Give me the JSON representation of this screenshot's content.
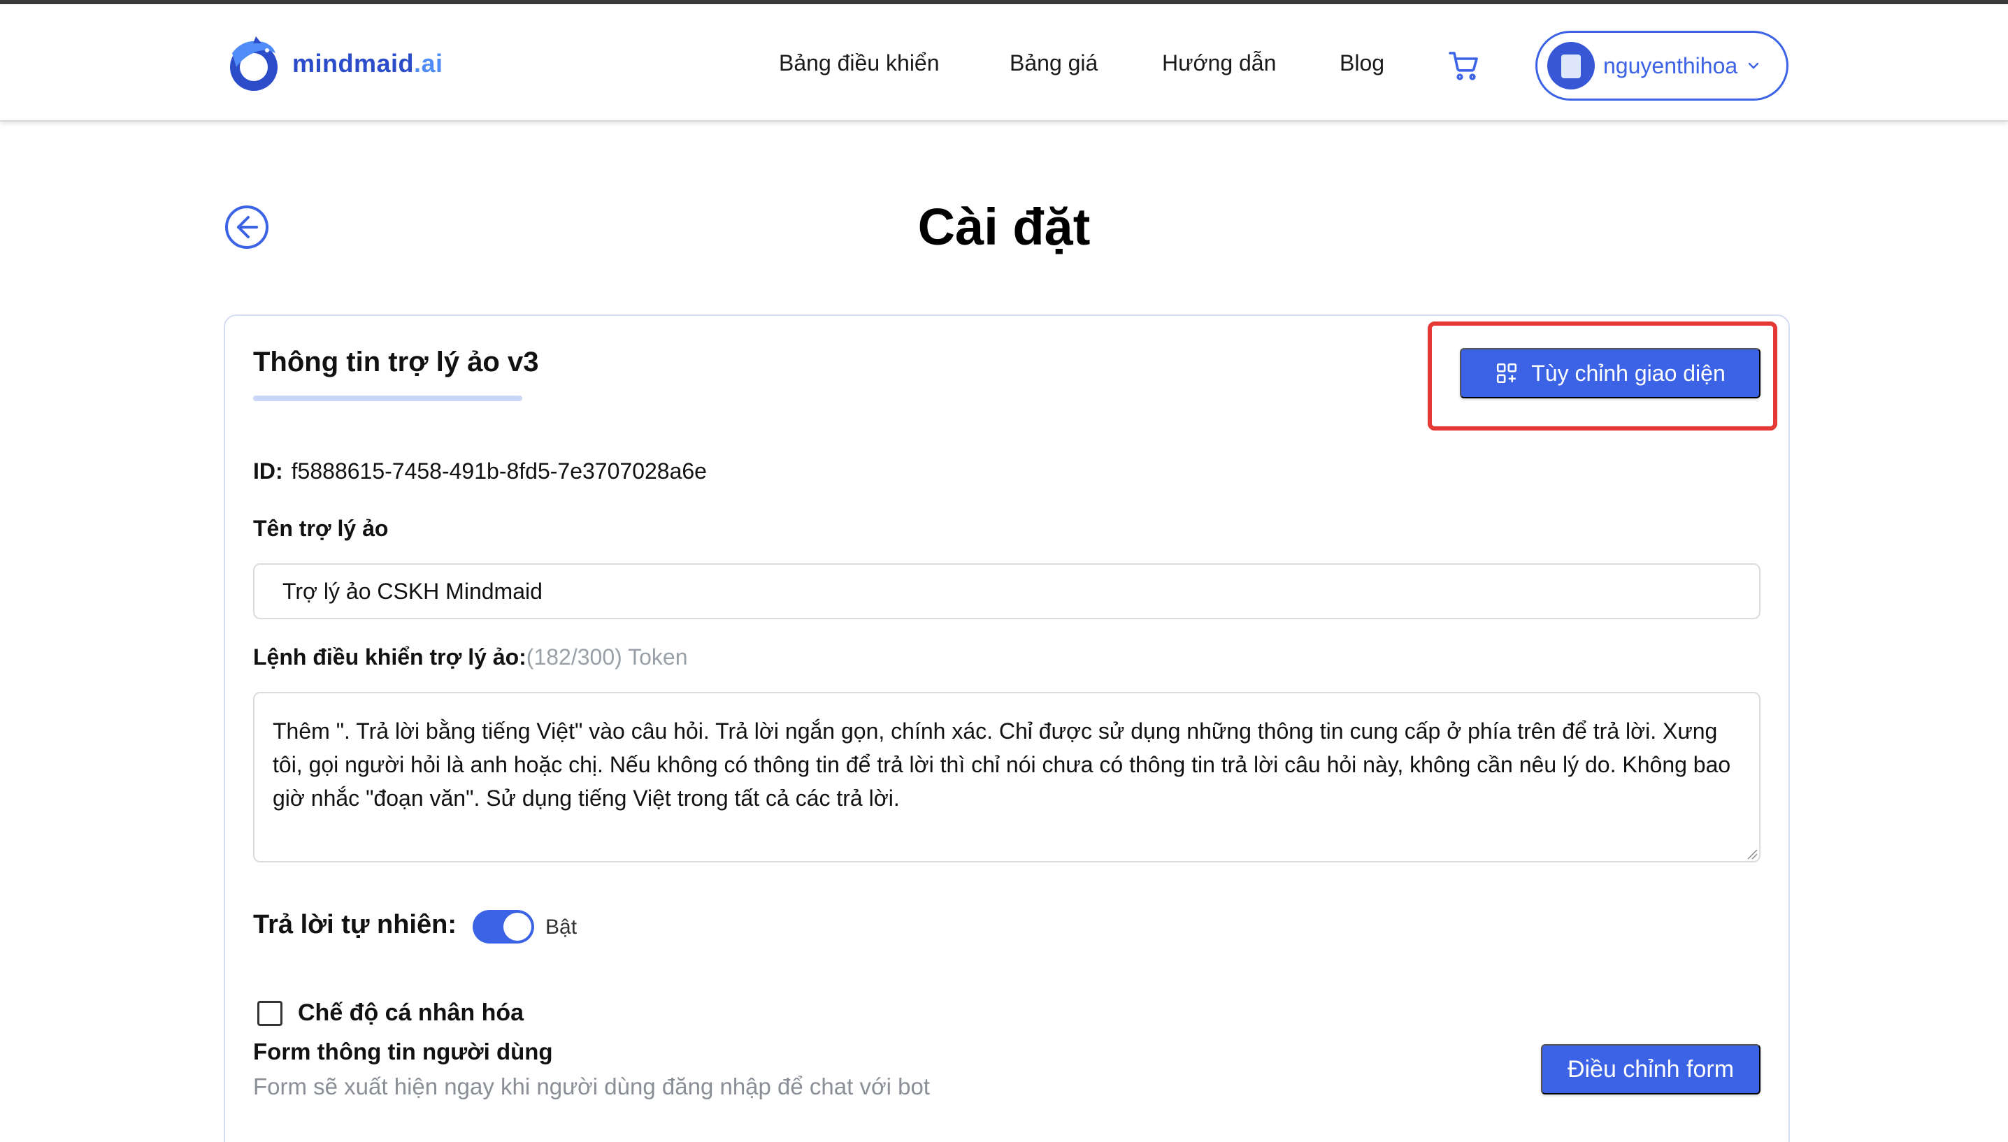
{
  "header": {
    "logo_text_main": "mindmaid",
    "logo_text_suffix": ".ai",
    "nav": [
      "Bảng điều khiển",
      "Bảng giá",
      "Hướng dẫn",
      "Blog"
    ],
    "username": "nguyenthihoa"
  },
  "page": {
    "title": "Cài đặt"
  },
  "card": {
    "title": "Thông tin trợ lý ảo v3",
    "customize_button": "Tùy chỉnh giao diện",
    "id_label": "ID:",
    "id_value": "f5888615-7458-491b-8fd5-7e3707028a6e",
    "name_label": "Tên trợ lý ảo",
    "name_value": "Trợ lý ảo CSKH Mindmaid",
    "prompt_label": "Lệnh điều khiển trợ lý ảo:",
    "prompt_token_note": "(182/300) Token",
    "prompt_value": "Thêm \". Trả lời bằng tiếng Việt\" vào câu hỏi. Trả lời ngắn gọn, chính xác. Chỉ được sử dụng những thông tin cung cấp ở phía trên để trả lời. Xưng tôi, gọi người hỏi là anh hoặc chị. Nếu không có thông tin để trả lời thì chỉ nói chưa có thông tin trả lời câu hỏi này, không cần nêu lý do. Không bao giờ nhắc \"đoạn văn\". Sử dụng tiếng Việt trong tất cả các trả lời.",
    "natural_label": "Trả lời tự nhiên:",
    "natural_state": "Bật",
    "personalize_label": "Chế độ cá nhân hóa",
    "user_form_title": "Form thông tin người dùng",
    "user_form_desc": "Form sẽ xuất hiện ngay khi người dùng đăng nhập để chat với bot",
    "edit_form_button": "Điều chỉnh form"
  },
  "colors": {
    "primary": "#3c63e6",
    "highlight": "#e53935"
  }
}
